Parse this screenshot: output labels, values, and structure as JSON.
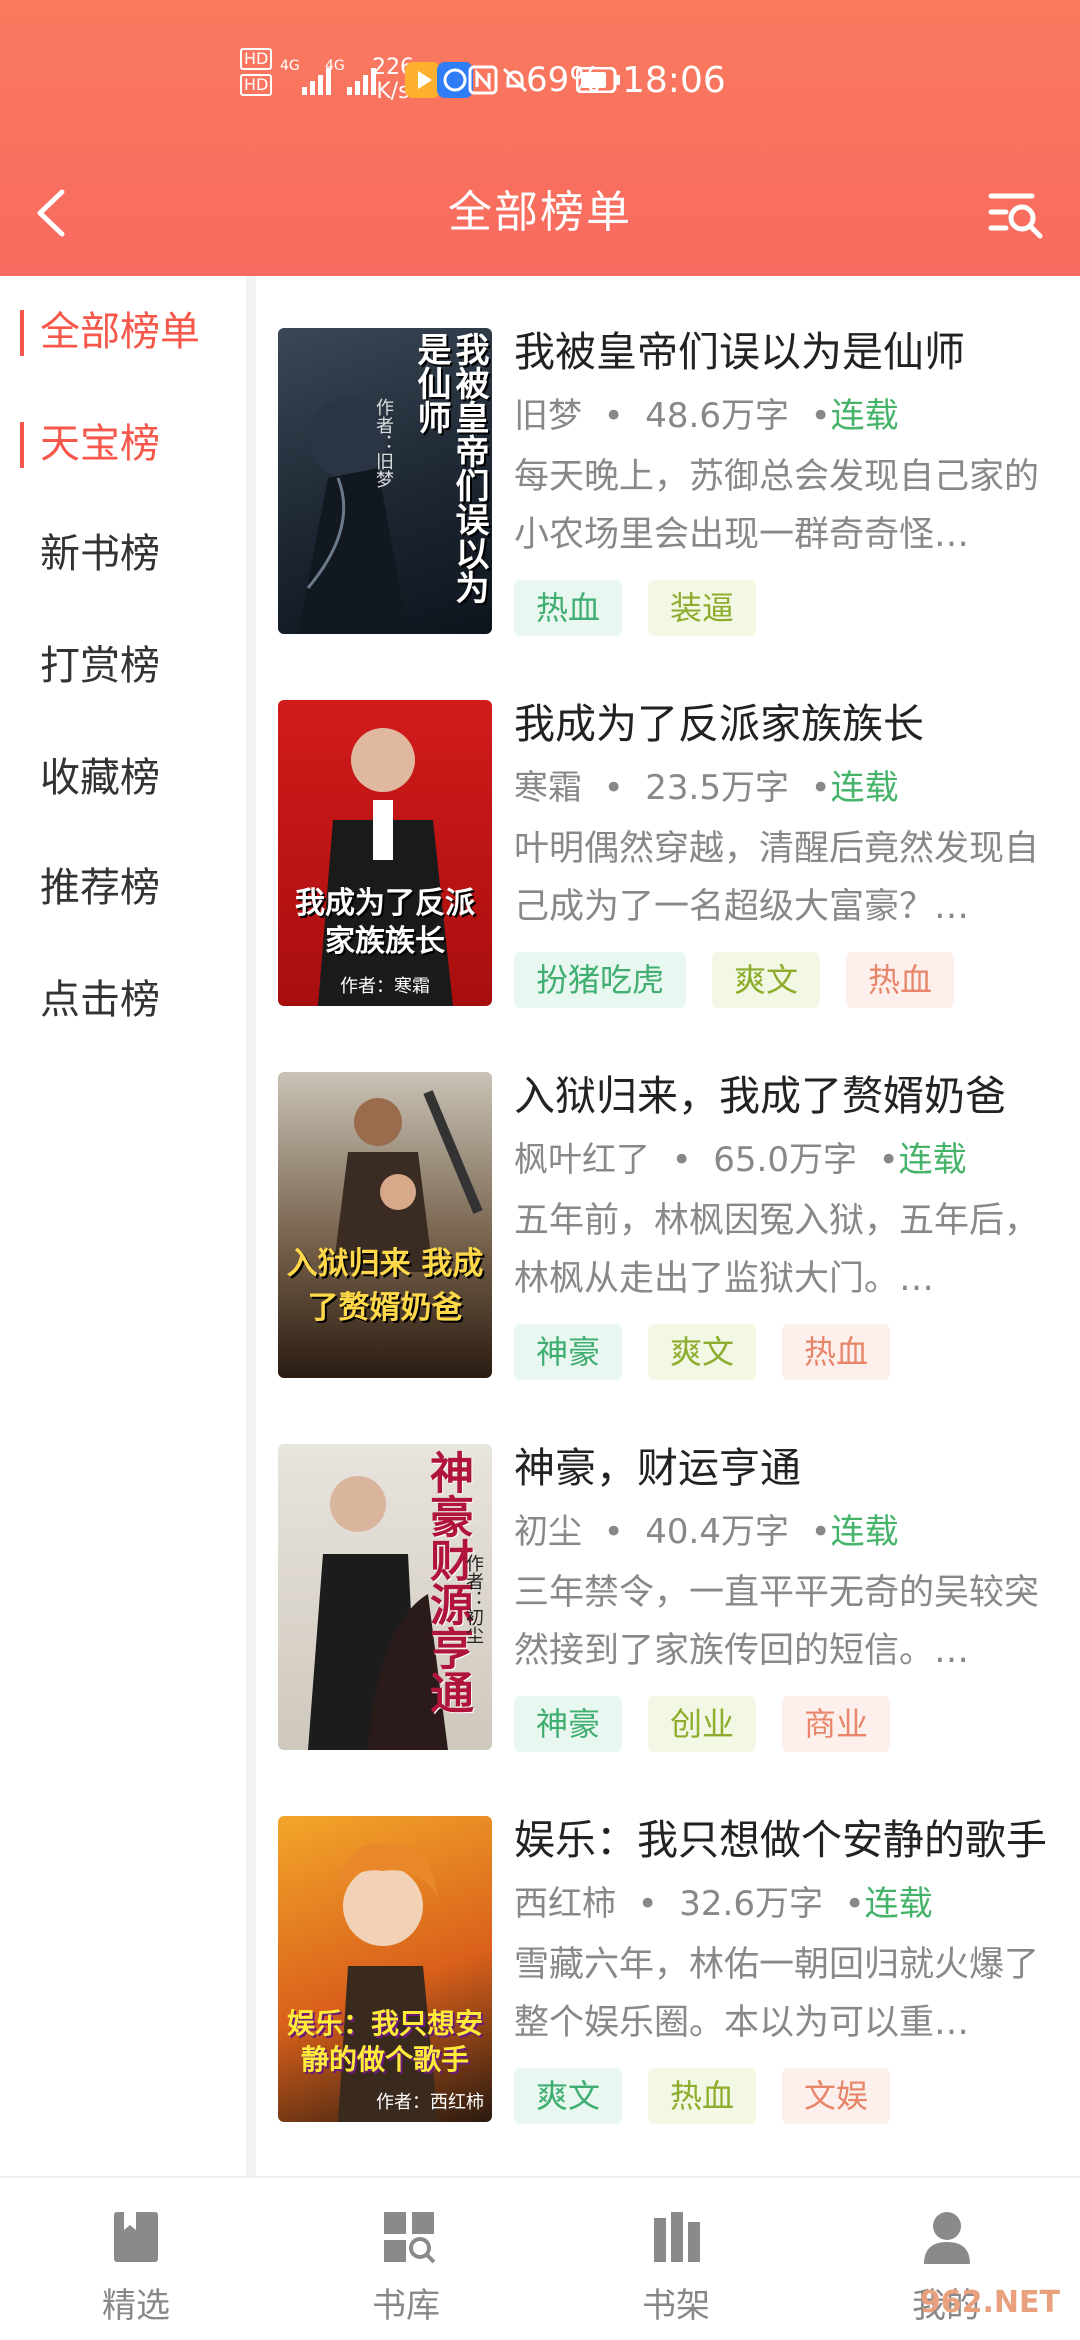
{
  "status_bar": {
    "hd1": "HD",
    "hd2": "HD",
    "net1": "4G",
    "net2": "4G",
    "speed_value": "226",
    "speed_unit": "K/s",
    "battery": "69%",
    "time": "18:06"
  },
  "nav": {
    "title": "全部榜单"
  },
  "sidebar": {
    "items": [
      {
        "label": "全部榜单",
        "active": true
      },
      {
        "label": "天宝榜",
        "active": true
      },
      {
        "label": "新书榜",
        "active": false
      },
      {
        "label": "打赏榜",
        "active": false
      },
      {
        "label": "收藏榜",
        "active": false
      },
      {
        "label": "推荐榜",
        "active": false
      },
      {
        "label": "点击榜",
        "active": false
      }
    ]
  },
  "books": [
    {
      "title": "我被皇帝们误以为是仙师",
      "author": "旧梦",
      "words": "48.6万字",
      "status": "连载",
      "desc": "每天晚上，苏御总会发现自己家的小农场里会出现一群奇奇怪…",
      "tags": [
        "热血",
        "装逼"
      ],
      "cover_text": "我被皇帝们误以为是仙师",
      "cover_author": "作者：旧梦"
    },
    {
      "title": "我成为了反派家族族长",
      "author": "寒霜",
      "words": "23.5万字",
      "status": "连载",
      "desc": "叶明偶然穿越，清醒后竟然发现自己成为了一名超级大富豪？…",
      "tags": [
        "扮猪吃虎",
        "爽文",
        "热血"
      ],
      "cover_text": "我成为了反派家族族长",
      "cover_author": "作者：寒霜"
    },
    {
      "title": "入狱归来，我成了赘婿奶爸",
      "author": "枫叶红了",
      "words": "65.0万字",
      "status": "连载",
      "desc": "五年前，林枫因冤入狱，五年后，林枫从走出了监狱大门。…",
      "tags": [
        "神豪",
        "爽文",
        "热血"
      ],
      "cover_text": "入狱归来 我成了赘婿奶爸",
      "cover_author": ""
    },
    {
      "title": "神豪，财运亨通",
      "author": "初尘",
      "words": "40.4万字",
      "status": "连载",
      "desc": "三年禁令，一直平平无奇的吴较突然接到了家族传回的短信。…",
      "tags": [
        "神豪",
        "创业",
        "商业"
      ],
      "cover_text": "神豪财源亨通",
      "cover_author": "作者：初尘"
    },
    {
      "title": "娱乐：我只想做个安静的歌手",
      "author": "西红柿",
      "words": "32.6万字",
      "status": "连载",
      "desc": "雪藏六年，林佑一朝回归就火爆了整个娱乐圈。本以为可以重…",
      "tags": [
        "爽文",
        "热血",
        "文娱"
      ],
      "cover_text": "娱乐：我只想安静的做个歌手",
      "cover_author": "作者：西红柿"
    }
  ],
  "tabs": [
    {
      "label": "精选",
      "icon": "bookmark-book-icon"
    },
    {
      "label": "书库",
      "icon": "library-grid-icon"
    },
    {
      "label": "书架",
      "icon": "bookshelf-icon"
    },
    {
      "label": "我的",
      "icon": "user-icon"
    }
  ],
  "watermark": "962.NET",
  "colors": {
    "header": "#f97a5f",
    "accent": "#f5584a",
    "status_green": "#46b36a"
  }
}
